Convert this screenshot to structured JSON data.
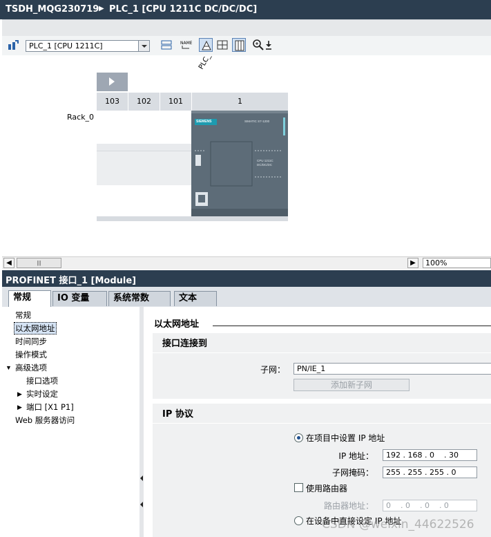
{
  "window": {
    "project": "TSDH_MQG230719",
    "device": "PLC_1 [CPU 1211C DC/DC/DC]"
  },
  "toolbar": {
    "device_select_value": "PLC_1 [CPU 1211C]",
    "rotated_label": "PLC_"
  },
  "device_view": {
    "rack_label": "Rack_0",
    "slots": [
      "103",
      "102",
      "101",
      "1"
    ],
    "cpu": {
      "brand": "SIEMENS",
      "family": "SIMATIC S7-1200",
      "model": "CPU 1211C DC/DC/DC"
    }
  },
  "scrollbar": {
    "zoom": "100%"
  },
  "inspector": {
    "title": "PROFINET 接口_1 [Module]",
    "tabs": [
      "常规",
      "IO 变量",
      "系统常数",
      "文本"
    ],
    "nav": [
      "常规",
      "以太网地址",
      "时间同步",
      "操作模式",
      "高级选项",
      "接口选项",
      "实时设定",
      "端口 [X1 P1]",
      "Web 服务器访问"
    ],
    "section_heading": "以太网地址",
    "interface_group": {
      "title": "接口连接到",
      "subnet_label": "子网：",
      "subnet_value": "PN/IE_1",
      "add_subnet_button": "添加新子网"
    },
    "ip_group": {
      "title": "IP 协议",
      "set_in_project": "在项目中设置 IP 地址",
      "ip_label": "IP 地址：",
      "ip_value": "192 . 168 . 0    . 30",
      "mask_label": "子网掩码：",
      "mask_value": "255 . 255 . 255 . 0",
      "use_router": "使用路由器",
      "router_label": "路由器地址：",
      "router_value": "0    . 0    . 0    . 0",
      "set_on_device": "在设备中直接设定 IP 地址"
    }
  },
  "watermark": "CSDN @weixin_44622526"
}
